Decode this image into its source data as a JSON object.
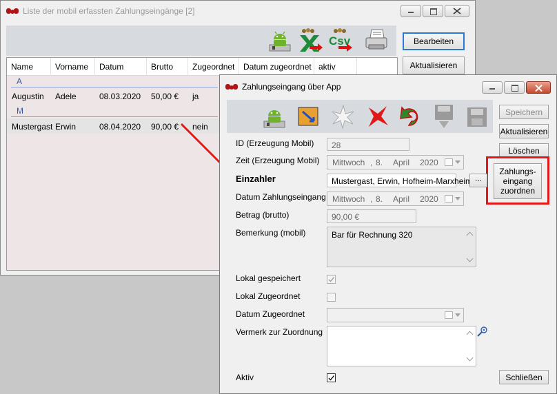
{
  "list_window": {
    "title": "Liste der mobil erfassten Zahlungseingänge [2]",
    "buttons": {
      "edit": "Bearbeiten",
      "refresh": "Aktualisieren"
    },
    "columns": [
      "Name",
      "Vorname",
      "Datum",
      "Brutto",
      "Zugeordnet",
      "Datum zugeordnet",
      "aktiv"
    ],
    "groups": [
      {
        "letter": "A",
        "rows": [
          {
            "name": "Augustin",
            "vorname": "Adele",
            "datum": "08.03.2020",
            "brutto": "50,00 €",
            "zugeordnet": "ja"
          }
        ]
      },
      {
        "letter": "M",
        "rows": [
          {
            "name": "Mustergast",
            "vorname": "Erwin",
            "datum": "08.04.2020",
            "brutto": "90,00 €",
            "zugeordnet": "nein"
          }
        ]
      }
    ],
    "toolbar_icons": [
      "android-scan-icon",
      "excel-export-icon",
      "csv-export-icon",
      "print-icon"
    ]
  },
  "detail_window": {
    "title": "Zahlungseingang über App",
    "buttons": {
      "save": "Speichern",
      "refresh": "Aktualisieren",
      "delete": "Löschen",
      "assign_line1": "Zahlungs-",
      "assign_line2": "eingang",
      "assign_line3": "zuordnen",
      "close": "Schließen",
      "ellipsis": "..."
    },
    "labels": {
      "id": "ID (Erzeugung Mobil)",
      "zeit": "Zeit (Erzeugung Mobil)",
      "einzahler": "Einzahler",
      "datum_eingang": "Datum Zahlungseingang",
      "betrag": "Betrag (brutto)",
      "bemerkung": "Bemerkung (mobil)",
      "lokal_gespeichert": "Lokal gespeichert",
      "lokal_zugeordnet": "Lokal Zugeordnet",
      "datum_zugeordnet": "Datum Zugeordnet",
      "vermerk": "Vermerk zur Zuordnung",
      "aktiv": "Aktiv"
    },
    "values": {
      "id": "28",
      "zeit": {
        "weekday": "Mittwoch",
        "sep": ",",
        "day": "8.",
        "month": "April",
        "year": "2020"
      },
      "einzahler": "Mustergast, Erwin, Hofheim-Marxheim",
      "datum_eingang": {
        "weekday": "Mittwoch",
        "sep": ",",
        "day": "8.",
        "month": "April",
        "year": "2020"
      },
      "betrag": "90,00 €",
      "bemerkung": "Bar für Rechnung 320",
      "lokal_gespeichert": true,
      "lokal_zugeordnet": false,
      "aktiv": true
    },
    "toolbar_icons": [
      "android-scan-icon",
      "assign-icon",
      "new-star-icon",
      "delete-x-icon",
      "undo-icon",
      "save-download-icon",
      "save-icon"
    ]
  }
}
